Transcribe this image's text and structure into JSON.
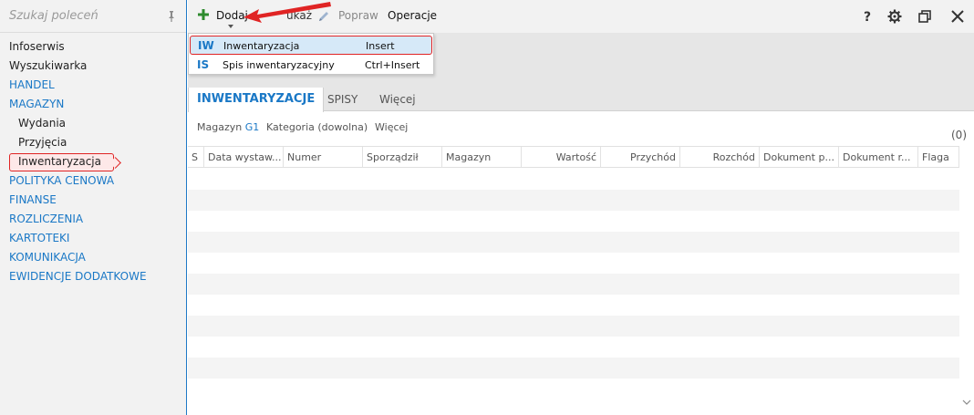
{
  "sidebar": {
    "search_placeholder": "Szukaj poleceń",
    "items": [
      {
        "label": "Infoserwis"
      },
      {
        "label": "Wyszukiwarka"
      },
      {
        "label": "HANDEL"
      },
      {
        "label": "MAGAZYN"
      },
      {
        "label": "Wydania"
      },
      {
        "label": "Przyjęcia"
      },
      {
        "label": "Inwentaryzacja"
      },
      {
        "label": "POLITYKA CENOWA"
      },
      {
        "label": "FINANSE"
      },
      {
        "label": "ROZLICZENIA"
      },
      {
        "label": "KARTOTEKI"
      },
      {
        "label": "KOMUNIKACJA"
      },
      {
        "label": "EWIDENCJE DODATKOWE"
      }
    ]
  },
  "toolbar": {
    "add_label": "Dodaj",
    "hidden_label": "ukaż",
    "edit_label": "Popraw",
    "operations_label": "Operacje"
  },
  "dropdown": {
    "items": [
      {
        "code": "IW",
        "label": "Inwentaryzacja",
        "shortcut": "Insert"
      },
      {
        "code": "IS",
        "label": "Spis inwentaryzacyjny",
        "shortcut": "Ctrl+Insert"
      }
    ]
  },
  "tabs": [
    {
      "label": "INWENTARYZACJE"
    },
    {
      "label": "SPISY"
    },
    {
      "label": "Więcej"
    }
  ],
  "filters": {
    "warehouse_label": "Magazyn",
    "warehouse_value": "G1",
    "category_label": "Kategoria (dowolna)",
    "more_label": "Więcej",
    "count": "(0)"
  },
  "grid": {
    "columns": [
      "S",
      "Data wystaw...",
      "Numer",
      "Sporządził",
      "Magazyn",
      "Wartość",
      "Przychód",
      "Rozchód",
      "Dokument p...",
      "Dokument r...",
      "Flaga"
    ]
  },
  "colors": {
    "accent": "#1a78c6",
    "highlight_red": "#e02424",
    "add_green": "#2e8b2e"
  }
}
